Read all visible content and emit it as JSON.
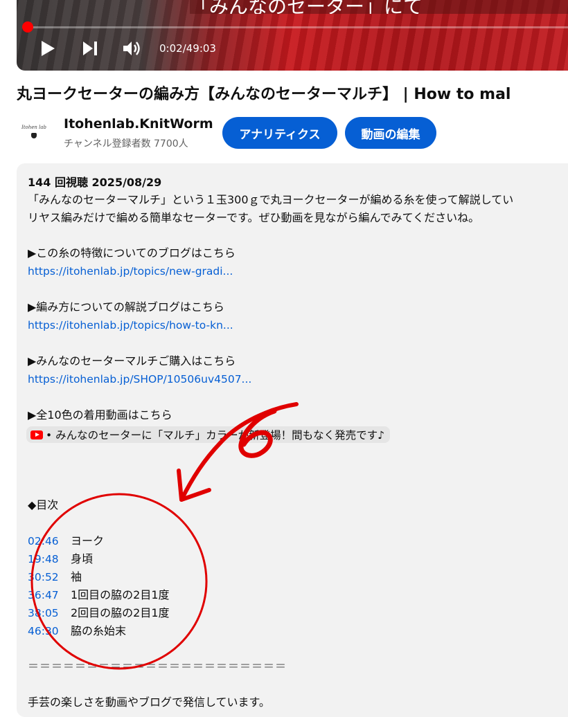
{
  "player": {
    "caption_partial": "「みんなのセーター」にて",
    "time_current": "0:02",
    "time_separator": " / ",
    "time_total": "49:03",
    "progress_fraction": 0.0007,
    "accent_color": "#ff0000",
    "icons": [
      "play-icon",
      "next-icon",
      "volume-icon"
    ]
  },
  "video": {
    "title": "丸ヨークセーターの編み方【みんなのセーターマルチ】 | How to mal"
  },
  "channel": {
    "avatar_text": "Itohen lab",
    "name": "Itohenlab.KnitWorm",
    "subscribers": "チャンネル登録者数 7700人"
  },
  "actions": {
    "analytics_label": "アナリティクス",
    "edit_label": "動画の編集",
    "button_color": "#065fd4"
  },
  "description": {
    "meta": "144 回視聴  2025/08/29",
    "intro_1": "「みんなのセーターマルチ」という１玉300ｇで丸ヨークセーターが編める糸を使って解説してい",
    "intro_2": "リヤス編みだけで編める簡単なセーターです。ぜひ動画を見ながら編んでみてくださいね。",
    "blog_heading": "▶この糸の特徴についてのブログはこちら",
    "blog_link": "https://itohenlab.jp/topics/new-gradi...",
    "howto_heading": "▶編み方についての解説ブログはこちら",
    "howto_link": "https://itohenlab.jp/topics/how-to-kn...",
    "buy_heading": "▶みんなのセーターマルチご購入はこちら",
    "buy_link": "https://itohenlab.jp/SHOP/10506uv4507...",
    "colors_heading": "▶全10色の着用動画はこちら",
    "video_chip": "• みんなのセーターに「マルチ」カラーが新登場！間もなく発売です♪",
    "toc_heading": "◆目次",
    "chapters": [
      {
        "time": "02:46",
        "label": "ヨーク"
      },
      {
        "time": "19:48",
        "label": "身頃"
      },
      {
        "time": "30:52",
        "label": "袖"
      },
      {
        "time": "36:47",
        "label": "1回目の脇の2目1度"
      },
      {
        "time": "38:05",
        "label": "2回目の脇の2目1度"
      },
      {
        "time": "46:30",
        "label": "脇の糸始末"
      }
    ],
    "divider": "＝＝＝＝＝＝＝＝＝＝＝＝＝＝＝＝＝＝＝＝＝＝",
    "footer_line": "手芸の楽しさを動画やブログで発信しています。"
  },
  "annotation": {
    "color": "#e00000",
    "shapes": [
      "arrow",
      "digit-6",
      "circle"
    ]
  }
}
